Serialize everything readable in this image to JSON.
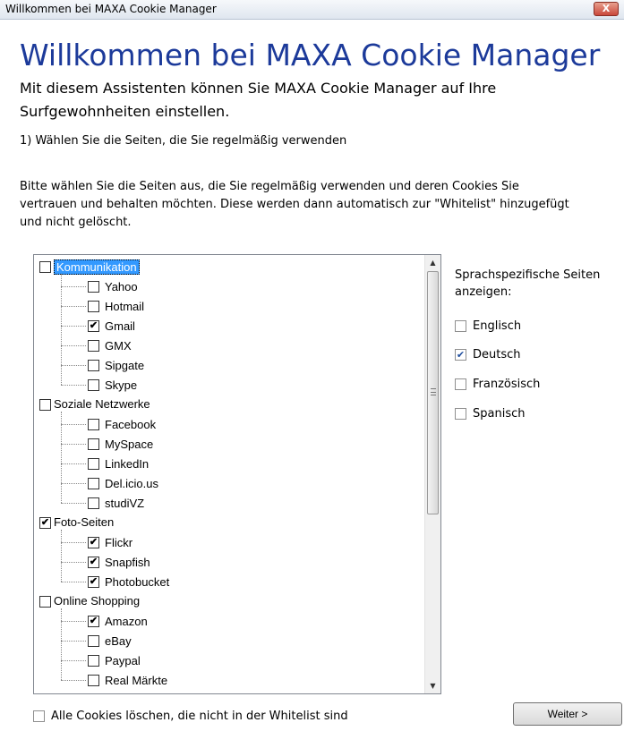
{
  "window": {
    "title": "Willkommen bei MAXA Cookie Manager",
    "close_label": "X"
  },
  "header": {
    "heading": "Willkommen bei MAXA Cookie Manager",
    "subtitle": "Mit diesem Assistenten können Sie MAXA Cookie Manager auf Ihre Surfgewohnheiten einstellen."
  },
  "step": "1) Wählen Sie die Seiten, die Sie regelmäßig verwenden",
  "description": "Bitte wählen Sie die Seiten aus, die Sie regelmäßig verwenden und deren Cookies Sie vertrauen und behalten möchten. Diese werden dann automatisch zur \"Whitelist\" hinzugefügt und nicht gelöscht.",
  "tree": {
    "groups": [
      {
        "label": "Kommunikation",
        "checked": false,
        "selected": true,
        "children": [
          {
            "label": "Yahoo",
            "checked": false
          },
          {
            "label": "Hotmail",
            "checked": false
          },
          {
            "label": "Gmail",
            "checked": true
          },
          {
            "label": "GMX",
            "checked": false
          },
          {
            "label": "Sipgate",
            "checked": false
          },
          {
            "label": "Skype",
            "checked": false
          }
        ]
      },
      {
        "label": "Soziale Netzwerke",
        "checked": false,
        "children": [
          {
            "label": "Facebook",
            "checked": false
          },
          {
            "label": "MySpace",
            "checked": false
          },
          {
            "label": "LinkedIn",
            "checked": false
          },
          {
            "label": "Del.icio.us",
            "checked": false
          },
          {
            "label": "studiVZ",
            "checked": false
          }
        ]
      },
      {
        "label": "Foto-Seiten",
        "checked": true,
        "children": [
          {
            "label": "Flickr",
            "checked": true
          },
          {
            "label": "Snapfish",
            "checked": true
          },
          {
            "label": "Photobucket",
            "checked": true
          }
        ]
      },
      {
        "label": "Online Shopping",
        "checked": false,
        "children": [
          {
            "label": "Amazon",
            "checked": true
          },
          {
            "label": "eBay",
            "checked": false
          },
          {
            "label": "Paypal",
            "checked": false
          },
          {
            "label": "Real Märkte",
            "checked": false
          }
        ]
      }
    ]
  },
  "languages": {
    "title": "Sprachspezifische Seiten anzeigen:",
    "options": [
      {
        "label": "Englisch",
        "checked": false
      },
      {
        "label": "Deutsch",
        "checked": true
      },
      {
        "label": "Französisch",
        "checked": false
      },
      {
        "label": "Spanisch",
        "checked": false
      }
    ]
  },
  "footer": {
    "delete_all_label": "Alle Cookies löschen, die nicht in der Whitelist sind",
    "delete_all_checked": false,
    "next_label": "Weiter >"
  }
}
